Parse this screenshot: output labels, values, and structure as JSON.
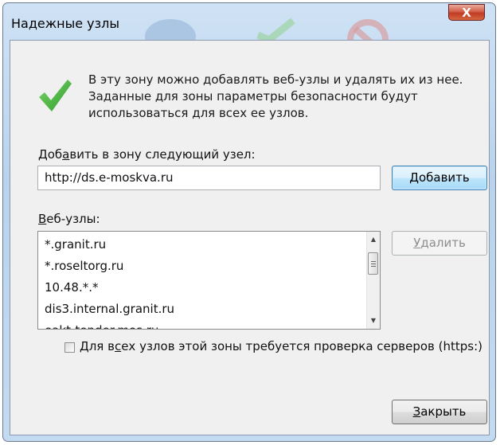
{
  "dialog": {
    "title": "Надежные узлы",
    "close_glyph": "X",
    "info_text": "В эту зону можно добавлять веб-узлы и удалять их из нее.\nЗаданные для зоны параметры безопасности будут\nиспользоваться для всех ее узлов.",
    "add_label_pre": "Доб",
    "add_label_key": "а",
    "add_label_post": "вить в зону следующий узел:",
    "url_value": "http://ds.e-moskva.ru",
    "add_button": "Добавить",
    "sites_label_key": "В",
    "sites_label_post": "еб-узлы:",
    "sites": [
      "*.granit.ru",
      "*.roseltorg.ru",
      "10.48.*.*",
      "dis3.internal.granit.ru",
      "eakt-tender.mos.ru"
    ],
    "delete_button_key": "У",
    "delete_button_post": "далить",
    "https_label_pre": "Для в",
    "https_label_key": "с",
    "https_label_post": "ех узлов этой зоны требуется проверка серверов (https:)",
    "https_checked": false,
    "close_button_key": "З",
    "close_button_post": "акрыть",
    "icon": "green-checkmark-icon"
  }
}
